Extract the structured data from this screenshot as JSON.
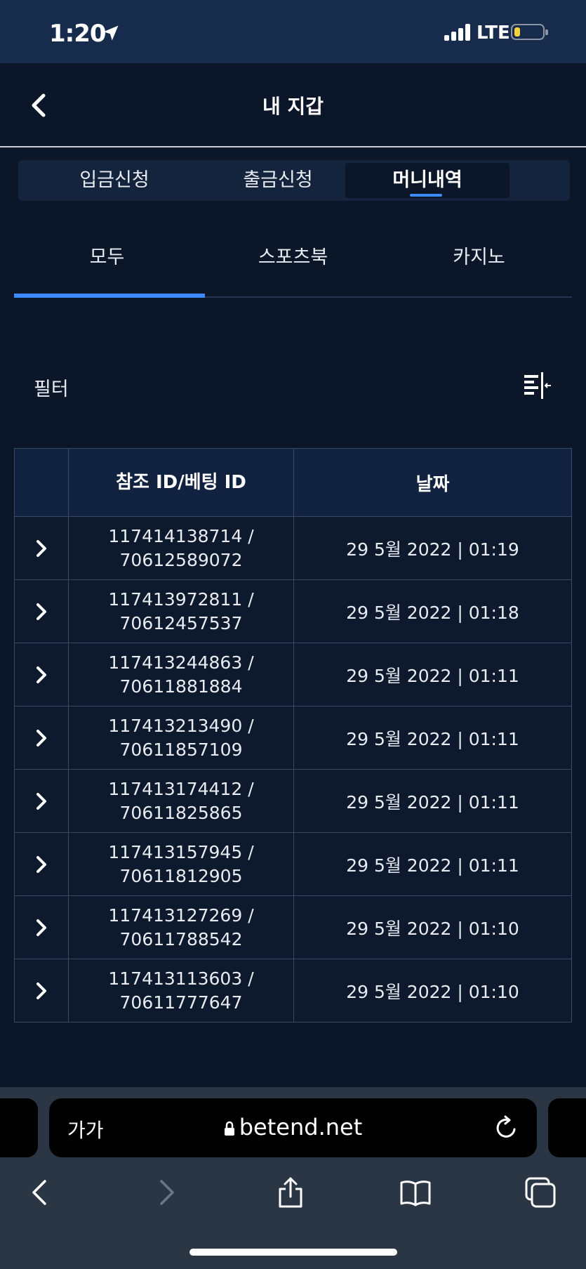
{
  "status_bar": {
    "time": "1:20",
    "network": "LTE"
  },
  "header": {
    "title": "내 지갑"
  },
  "segment_tabs": [
    {
      "label": "입금신청",
      "active": false
    },
    {
      "label": "출금신청",
      "active": false
    },
    {
      "label": "머니내역",
      "active": true
    }
  ],
  "sub_tabs": [
    {
      "label": "모두",
      "active": true
    },
    {
      "label": "스포츠북",
      "active": false
    },
    {
      "label": "카지노",
      "active": false
    }
  ],
  "filter": {
    "label": "필터"
  },
  "table": {
    "headers": [
      "",
      "참조 ID/베팅 ID",
      "날짜"
    ],
    "rows": [
      {
        "ref_id": "117414138714 /",
        "bet_id": "70612589072",
        "date": "29 5월 2022 | 01:19"
      },
      {
        "ref_id": "117413972811 /",
        "bet_id": "70612457537",
        "date": "29 5월 2022 | 01:18"
      },
      {
        "ref_id": "117413244863 /",
        "bet_id": "70611881884",
        "date": "29 5월 2022 | 01:11"
      },
      {
        "ref_id": "117413213490 /",
        "bet_id": "70611857109",
        "date": "29 5월 2022 | 01:11"
      },
      {
        "ref_id": "117413174412 /",
        "bet_id": "70611825865",
        "date": "29 5월 2022 | 01:11"
      },
      {
        "ref_id": "117413157945 /",
        "bet_id": "70611812905",
        "date": "29 5월 2022 | 01:11"
      },
      {
        "ref_id": "117413127269 /",
        "bet_id": "70611788542",
        "date": "29 5월 2022 | 01:10"
      },
      {
        "ref_id": "117413113603 /",
        "bet_id": "70611777647",
        "date": "29 5월 2022 | 01:10"
      }
    ]
  },
  "browser": {
    "text_size": "가가",
    "url": "betend.net"
  },
  "colors": {
    "background": "#0b1628",
    "accent": "#3d8bfd",
    "status_bar": "#172c4c",
    "table_header": "#112240"
  }
}
